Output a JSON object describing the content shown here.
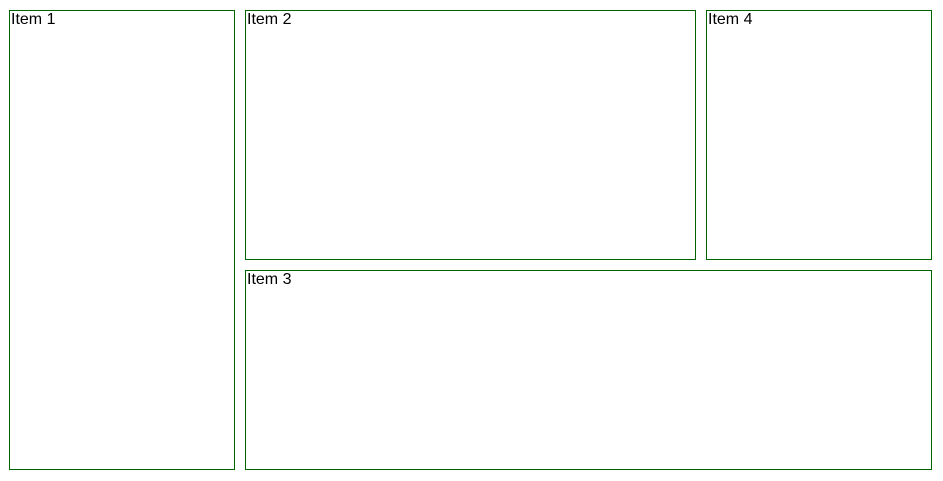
{
  "items": [
    {
      "label": "Item 1"
    },
    {
      "label": "Item 2"
    },
    {
      "label": "Item 3"
    },
    {
      "label": "Item 4"
    }
  ],
  "colors": {
    "border": "#006400",
    "background": "#ffffff",
    "text": "#000000"
  }
}
